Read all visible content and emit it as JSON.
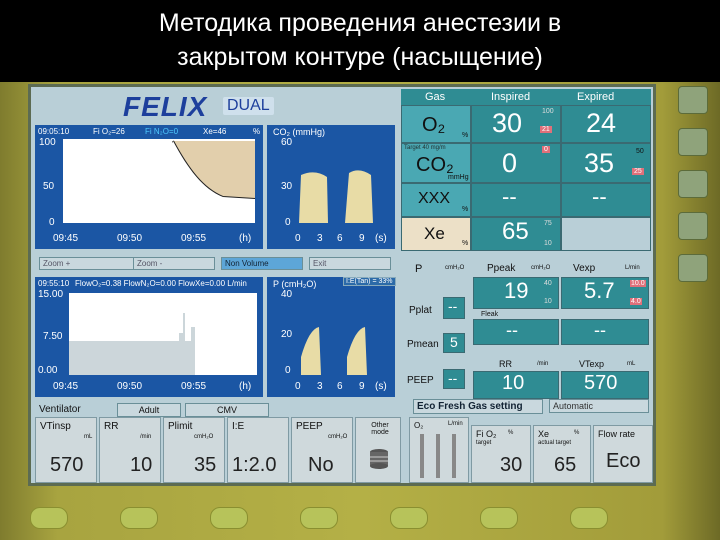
{
  "slide": {
    "title_line1": "Методика проведения анестезии в",
    "title_line2": "закрытом контуре (насыщение)"
  },
  "brand": {
    "name": "FELIX",
    "model": "DUAL"
  },
  "graph1": {
    "time": "09:05:10",
    "fio2": "Fi O₂=26",
    "fi_n2o": "Fi N₂O=0",
    "xe": "Xe=46",
    "pct": "%",
    "y_top": "100",
    "y_mid": "50",
    "y_zero": "0",
    "x_labels": [
      "09:45",
      "09:50",
      "09:55",
      "(h)"
    ]
  },
  "graph2": {
    "title": "CO₂ (mmHg)",
    "y_top": "60",
    "y_mid": "30",
    "y_zero": "0",
    "x_labels": [
      "0",
      "3",
      "6",
      "9",
      "(s)"
    ]
  },
  "tabs_row": [
    "Zoom +",
    "Zoom -",
    "Non Volume",
    "Exit"
  ],
  "graph3": {
    "time": "09:55:10",
    "header": "FlowO₂=0.38  FlowN₂O=0.00  FlowXe=0.00 L/min",
    "y_top": "15.00",
    "y_mid": "7.50",
    "y_zero": "0.00",
    "x_labels": [
      "09:45",
      "09:50",
      "09:55",
      "(h)"
    ]
  },
  "graph4": {
    "title": "P (cmH₂O)",
    "badge": "I:E(Tan) = 33%",
    "y_top": "40",
    "y_mid": "20",
    "y_zero": "0",
    "x_labels": [
      "0",
      "3",
      "6",
      "9",
      "(s)"
    ]
  },
  "gas_table": {
    "headers": [
      "Gas",
      "Inspired",
      "Expired"
    ],
    "rows": [
      {
        "name": "O₂",
        "unit": "%",
        "inspired": "30",
        "expired": "24",
        "insp_max": "100",
        "insp_min": "21",
        "note": "Target 40 mg/m"
      },
      {
        "name": "CO₂",
        "unit": "mmHg",
        "inspired": "0",
        "expired": "35",
        "insp_max": "0",
        "exp_max": "50",
        "exp_min": "25",
        "note": "Target 40 mg/m"
      },
      {
        "name": "XXX",
        "unit": "%",
        "inspired": "--",
        "expired": "--"
      },
      {
        "name": "Xe",
        "unit": "%",
        "inspired": "65",
        "insp_max": "75",
        "insp_min": "10"
      }
    ]
  },
  "pressure": {
    "p_label": "P",
    "p_unit": "cmH₂O",
    "ppeak_label": "Ppeak",
    "ppeak_unit": "cmH₂O",
    "ppeak_value": "19",
    "ppeak_max": "40",
    "ppeak_min": "10",
    "vexp_label": "Vexp",
    "vexp_unit": "L/min",
    "vexp_value": "5.7",
    "vexp_max": "10.0",
    "vexp_min": "4.0",
    "pplat_label": "Pplat",
    "pplat_value": "--",
    "fleak_label": "Fleak",
    "fleak_value": "--",
    "pmean_label": "Pmean",
    "pmean_value": "5",
    "rr_label": "RR",
    "rr_unit": "/min",
    "rr_value": "10",
    "vtexp_label": "VTexp",
    "vtexp_unit": "mL",
    "vtexp_value": "570",
    "peep_label": "PEEP",
    "peep_value": "--"
  },
  "ventilator": {
    "label": "Ventilator",
    "patient": "Adult",
    "mode": "CMV"
  },
  "eco": {
    "title": "Eco Fresh Gas setting",
    "automatic": "Automatic"
  },
  "settings": [
    {
      "label": "VTinsp",
      "unit": "mL",
      "value": "570"
    },
    {
      "label": "RR",
      "unit": "/min",
      "value": "10"
    },
    {
      "label": "Plimit",
      "unit": "cmH₂O",
      "value": "35"
    },
    {
      "label": "I:E",
      "unit": "",
      "value": "1:2.0"
    },
    {
      "label": "PEEP",
      "unit": "cmH₂O",
      "value": "No"
    },
    {
      "label": "Other mode",
      "unit": "",
      "value": ""
    }
  ],
  "fresh_gas": [
    {
      "label": "O₂",
      "unit": "L/min"
    },
    {
      "label": "Fi O₂",
      "unit": "%",
      "sub": "target",
      "value": "30"
    },
    {
      "label": "Xe",
      "unit": "%",
      "sub": "actual target",
      "value": "65"
    },
    {
      "label": "Flow rate",
      "unit": "",
      "value": "Eco"
    }
  ],
  "colors": {
    "screen": "#b9cfd7",
    "graph_bg": "#1b56a4",
    "value_teal": "#2f8c93",
    "value_beige": "#ece0c7",
    "alarm": "#e0707a",
    "trace": "#e8dca6",
    "frame": "#b4b046"
  }
}
